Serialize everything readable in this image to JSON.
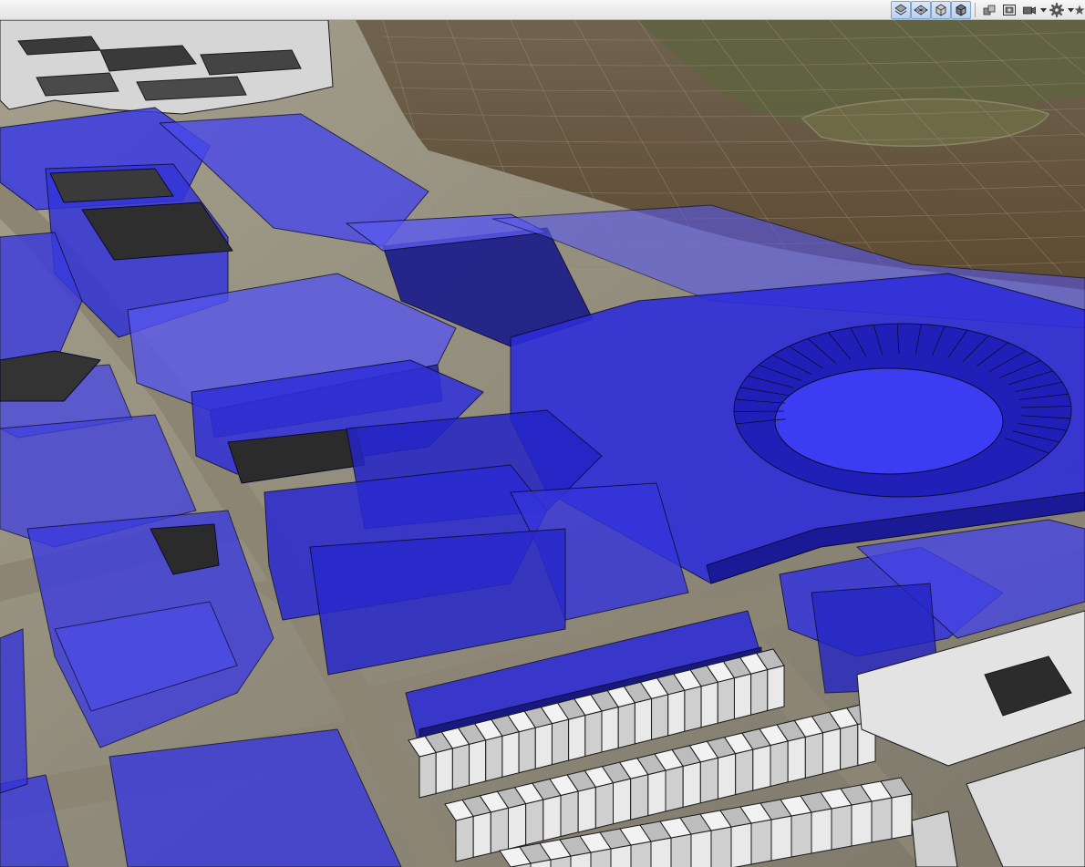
{
  "window": {
    "title": ""
  },
  "toolbar": {
    "buttons": [
      {
        "id": "layer-view",
        "icon": "layer-view-icon",
        "active": true
      },
      {
        "id": "grid-view",
        "icon": "grid-view-icon",
        "active": true
      },
      {
        "id": "solid-box",
        "icon": "solid-box-icon",
        "active": true
      },
      {
        "id": "textured-box",
        "icon": "textured-box-icon",
        "active": true
      },
      {
        "id": "scene-objects",
        "icon": "scene-objects-icon",
        "active": false
      },
      {
        "id": "screenshot",
        "icon": "camera-frame-icon",
        "active": false
      },
      {
        "id": "video-camera",
        "icon": "video-camera-icon",
        "active": false
      },
      {
        "id": "settings",
        "icon": "gear-icon",
        "active": false
      },
      {
        "id": "favorites",
        "icon": "star-icon",
        "active": false
      }
    ]
  },
  "colors": {
    "toolbar_bg": "#ececec",
    "building_fill": "#2a2ae8",
    "building_roof": "#5c5cf0",
    "building_dark": "#14147a",
    "river": "#6b5a3e",
    "grid": "#a99b86",
    "white_building": "#e4e4e4",
    "dark_roof": "#2b2b2b"
  },
  "scene": {
    "kind": "3d-city-view",
    "features": [
      "river",
      "grid-overlay",
      "stadium",
      "translucent-blue-buildings",
      "white-buildings",
      "streets"
    ]
  }
}
